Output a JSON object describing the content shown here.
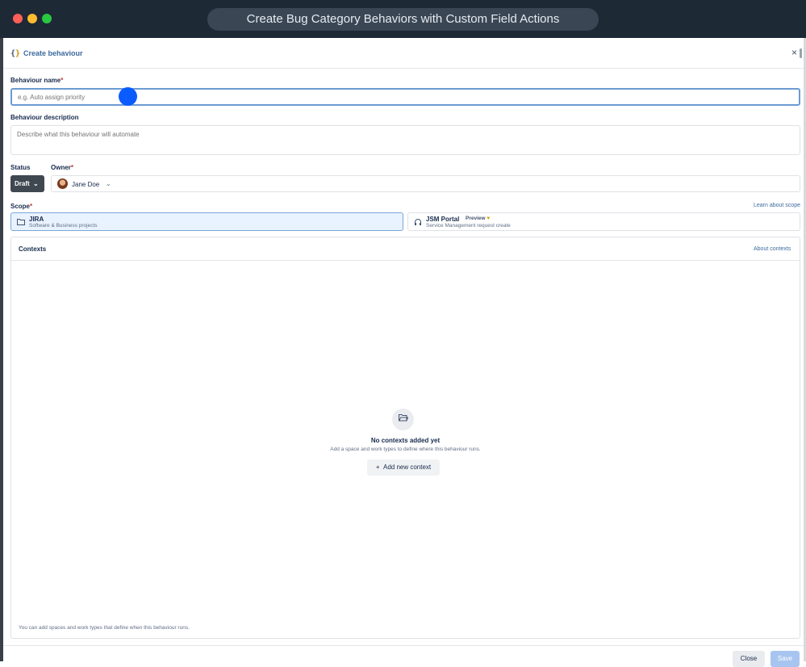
{
  "window": {
    "title": "Create Bug Category Behaviors with Custom Field Actions"
  },
  "modal": {
    "title": "Create behaviour",
    "close_glyph": "×"
  },
  "form": {
    "name_label": "Behaviour name",
    "name_placeholder": "e.g. Auto assign priority",
    "name_value": "",
    "description_label": "Behaviour description",
    "description_placeholder": "Describe what this behaviour will automate",
    "required_mark": "*",
    "status_label": "Status",
    "status_value": "Draft",
    "owner_label": "Owner",
    "owner_value": "Jane Doe",
    "scope_label": "Scope",
    "learn_scope_link": "Learn about scope"
  },
  "scope_options": [
    {
      "title": "JIRA",
      "subtitle": "Software & Business projects",
      "selected": true,
      "icon": "folder-icon"
    },
    {
      "title": "JSM Portal",
      "badge": "Preview",
      "subtitle": "Service Management request create",
      "selected": false,
      "icon": "headset-icon"
    }
  ],
  "contexts": {
    "title": "Contexts",
    "about_link": "About contexts",
    "empty_title": "No contexts added yet",
    "empty_subtitle": "Add a space and work types to define where this behaviour runs.",
    "add_button": "Add new context",
    "footer_note": "You can add spaces and work types that define when this behaviour runs."
  },
  "footer": {
    "close_label": "Close",
    "save_label": "Save"
  },
  "colors": {
    "title_bar": "#1e2936",
    "accent_link": "#3d6a9e",
    "status_button": "#3f4750",
    "selected_scope_bg": "#e9f2ff",
    "save_disabled": "#a8c5f0",
    "cursor_marker": "#0b5cff"
  }
}
